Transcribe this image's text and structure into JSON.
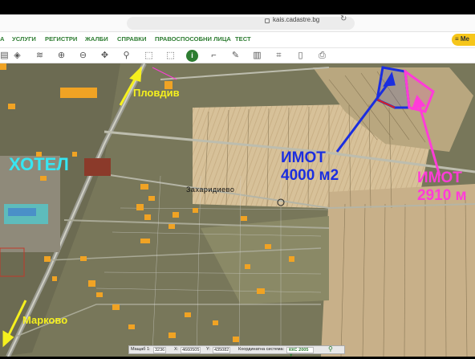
{
  "browser": {
    "url": "kais.cadastre.bg"
  },
  "nav": {
    "items": [
      "А",
      "УСЛУГИ",
      "РЕГИСТРИ",
      "ЖАЛБИ",
      "СПРАВКИ",
      "ПРАВОСПОСОБНИ ЛИЦА",
      "ТЕСТ"
    ],
    "menu_label": "≡ Ме"
  },
  "toolbar": {
    "icons": [
      "layers-icon",
      "layers-alt-icon",
      "zoom-in-icon",
      "zoom-out-icon",
      "pan-icon",
      "pin-icon",
      "select-rect-icon",
      "select-rect-alt-icon",
      "info-icon",
      "measure-angle-icon",
      "draw-icon",
      "map-icon",
      "crop-icon",
      "document-icon",
      "print-icon"
    ]
  },
  "map": {
    "labels": {
      "plovdiv": "Пловдив",
      "hotel": "ХОТЕЛ",
      "imot1_line1": "ИМОТ",
      "imot1_line2": "4000 м2",
      "imot2_line1": "ИМОТ",
      "imot2_line2": "2910 м",
      "village": "Захаридиево",
      "markovo": "Марково"
    },
    "colors": {
      "yellow": "#f5f01e",
      "blue": "#1b2ee0",
      "magenta": "#ff3cd8",
      "cyan": "#36e6f2",
      "property_orange": "#f0a324"
    }
  },
  "status": {
    "scale_label": "Мащаб 1:",
    "scale_value": "3236",
    "x_label": "X:",
    "x_value": "4660505",
    "y_label": "Y:",
    "y_value": "435082",
    "crs_label": "Координатна система:",
    "crs_value": "ККС 2005 ▼"
  }
}
